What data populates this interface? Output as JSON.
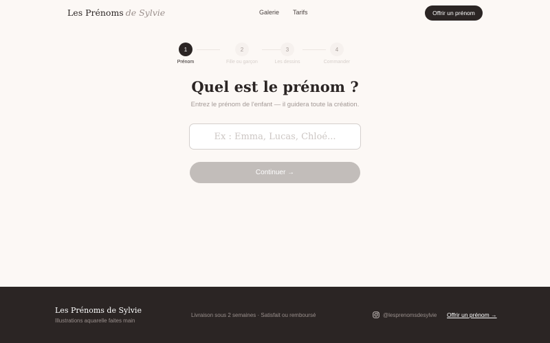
{
  "header": {
    "brand": "Les Prénoms",
    "brand_accent": "de Sylvie",
    "nav": [
      {
        "label": "Galerie"
      },
      {
        "label": "Tarifs"
      }
    ],
    "cta_label": "Offrir un prénom"
  },
  "stepper": {
    "current_step": 1,
    "steps": [
      {
        "number": "1",
        "label": "Prénom"
      },
      {
        "number": "2",
        "label": "Fille ou garçon"
      },
      {
        "number": "3",
        "label": "Les dessins"
      },
      {
        "number": "4",
        "label": "Commander"
      }
    ]
  },
  "main": {
    "title": "Quel est le prénom ?",
    "subtitle": "Entrez le prénom de l'enfant — il guidera toute la création.",
    "input_placeholder": "Ex : Emma, Lucas, Chloé...",
    "input_value": "",
    "continue_label": "Continuer →"
  },
  "footer": {
    "brand": "Les Prénoms de Sylvie",
    "tagline": "Illustrations aquarelle faites main",
    "info": "Livraison sous 2 semaines · Satisfait ou remboursé",
    "instagram_handle": "@lesprenomsdesylvie",
    "cta_label": "Offrir un prénom →"
  },
  "colors": {
    "background": "#fcf8f5",
    "dark": "#2b2524",
    "button_disabled": "#c2bdba",
    "muted_text": "#a29895"
  },
  "icons": {
    "instagram": "instagram-icon"
  }
}
